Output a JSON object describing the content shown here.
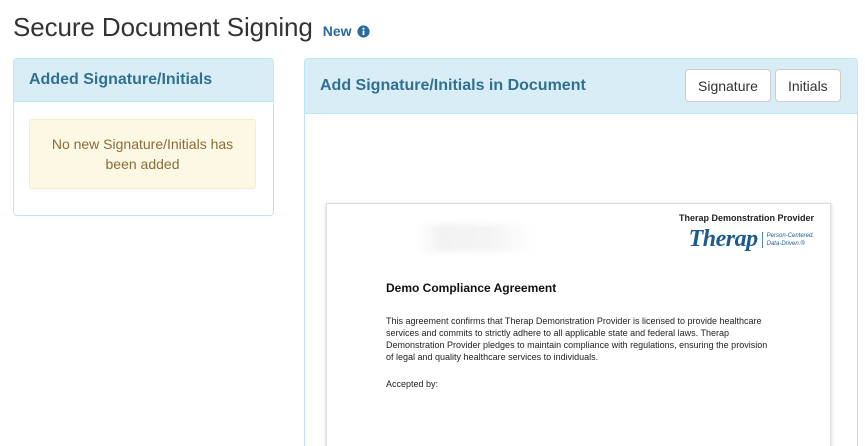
{
  "header": {
    "title": "Secure Document Signing",
    "new_label": "New",
    "info_icon": "info-circle-icon"
  },
  "left_panel": {
    "title": "Added Signature/Initials",
    "empty_message": "No new Signature/Initials has been added"
  },
  "right_panel": {
    "title": "Add Signature/Initials in Document",
    "signature_button": "Signature",
    "initials_button": "Initials"
  },
  "document": {
    "provider_name": "Therap Demonstration Provider",
    "logo_word": "Therap",
    "logo_tagline_1": "Person-Centered.",
    "logo_tagline_2": "Data-Driven.®",
    "title": "Demo Compliance Agreement",
    "body": "This agreement confirms that Therap Demonstration Provider is licensed to provide healthcare services and commits to strictly adhere to all applicable state and federal laws. Therap Demonstration Provider pledges to maintain compliance with regulations, ensuring the provision of legal and quality healthcare services to individuals.",
    "accepted_by": "Accepted by:"
  },
  "colors": {
    "panel_heading_bg": "#d9edf7",
    "panel_border": "#bce8f1",
    "panel_title": "#31708f",
    "new_label": "#2b6b9c",
    "alert_bg": "#fcf8e3",
    "alert_text": "#8a6d3b",
    "logo": "#1f5a8c"
  }
}
